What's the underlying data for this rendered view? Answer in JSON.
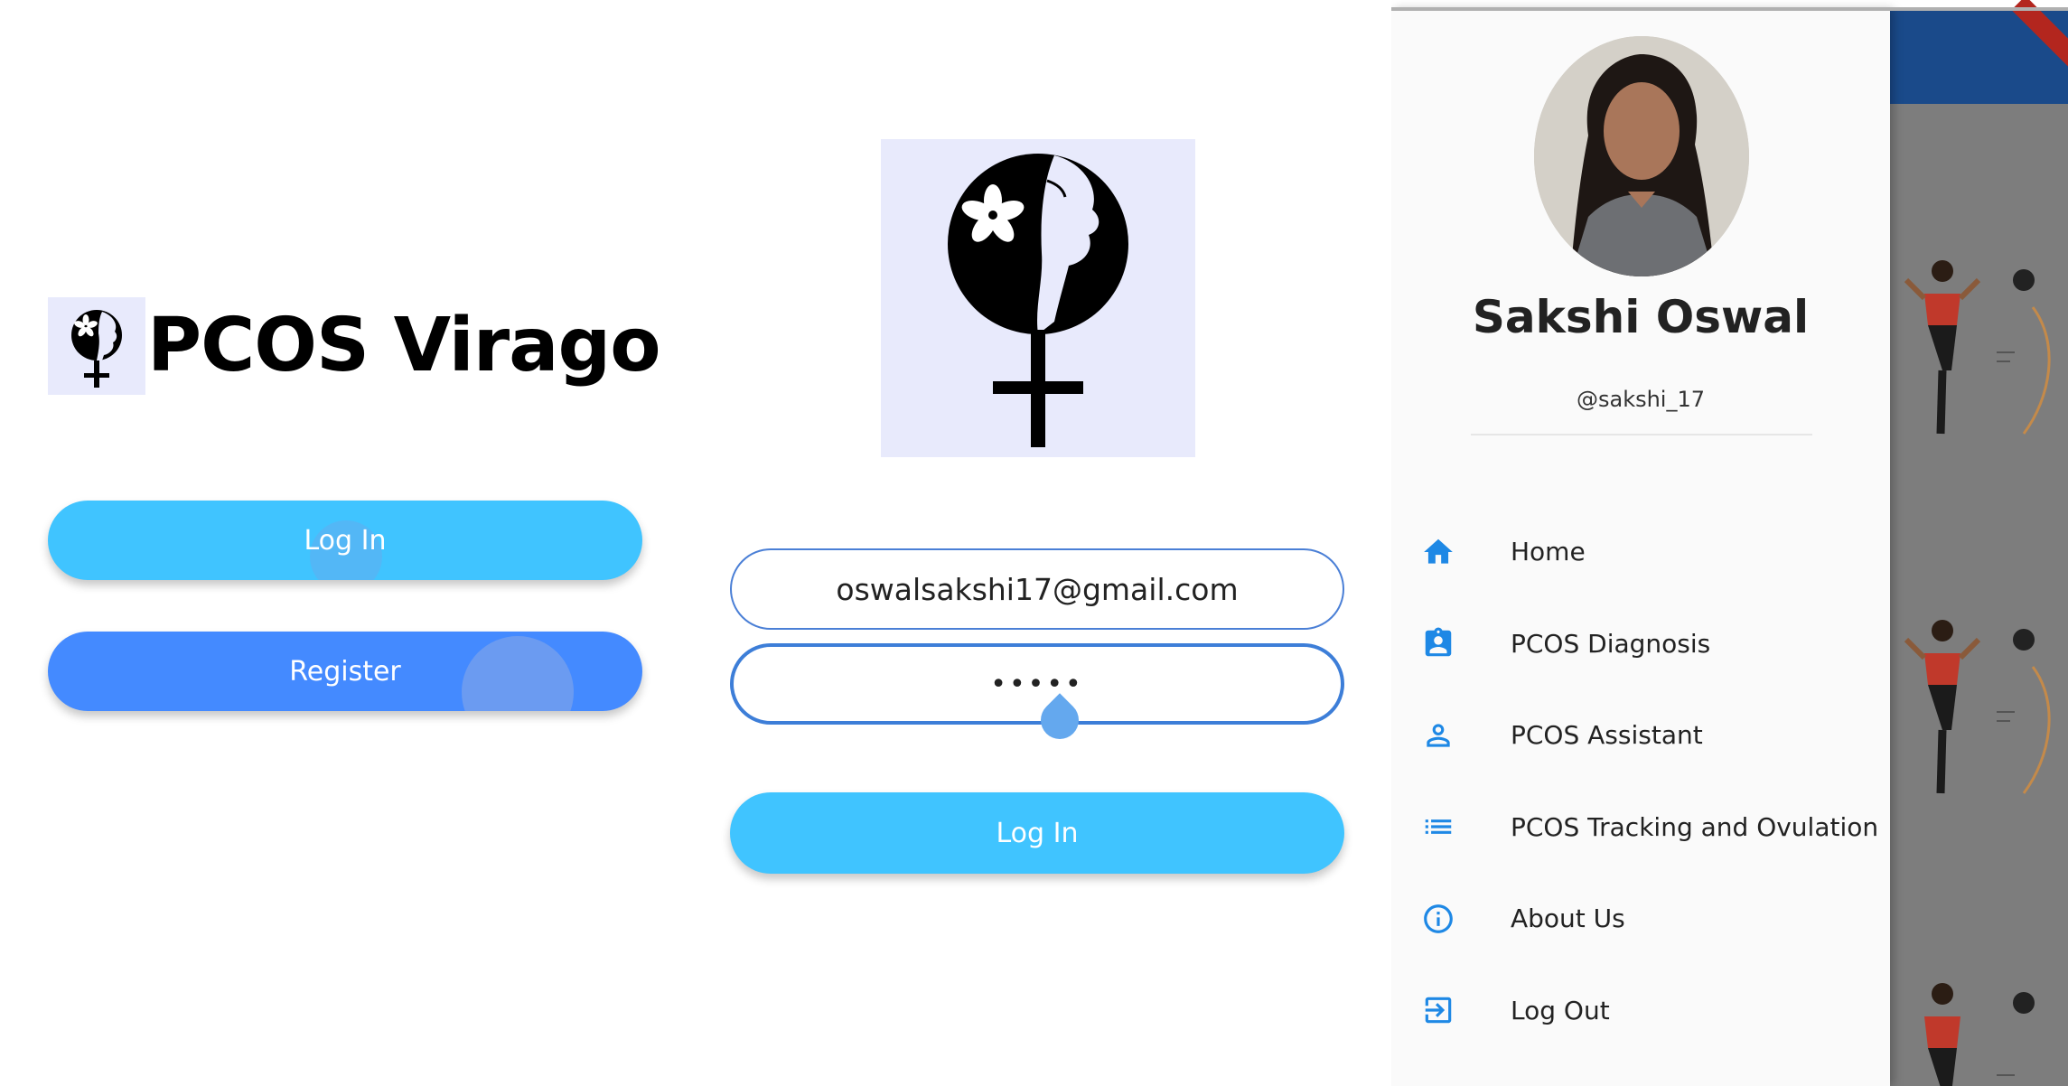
{
  "welcome": {
    "app_title": "PCOS Virago",
    "login_label": "Log In",
    "register_label": "Register"
  },
  "login_form": {
    "email_value": "oswalsakshi17@gmail.com",
    "password_value": "•••••",
    "login_label": "Log In"
  },
  "drawer": {
    "user_name": "Sakshi Oswal",
    "user_handle": "@sakshi_17",
    "menu": [
      {
        "label": "Home",
        "icon": "home-icon"
      },
      {
        "label": "PCOS Diagnosis",
        "icon": "clipboard-user-icon"
      },
      {
        "label": "PCOS Assistant",
        "icon": "person-icon"
      },
      {
        "label": "PCOS Tracking and Ovulation",
        "icon": "list-icon"
      },
      {
        "label": "About Us",
        "icon": "info-icon"
      },
      {
        "label": "Log Out",
        "icon": "logout-icon"
      }
    ]
  },
  "colors": {
    "primary_light_blue": "#40c4ff",
    "primary_blue": "#448aff",
    "icon_blue": "#1e88e5",
    "logo_bg": "#e8eafc"
  }
}
